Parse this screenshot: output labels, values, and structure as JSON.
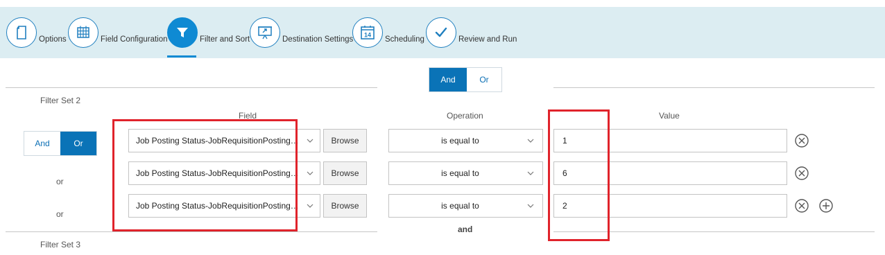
{
  "steps": [
    {
      "label": "Options",
      "icon": "document-icon",
      "active": false
    },
    {
      "label": "Field Configuration",
      "icon": "grid-icon",
      "active": false
    },
    {
      "label": "Filter and Sort",
      "icon": "filter-icon",
      "active": true
    },
    {
      "label": "Destination Settings",
      "icon": "presentation-board-icon",
      "active": false
    },
    {
      "label": "Scheduling",
      "icon": "calendar-icon",
      "active": false,
      "calendar_day": "14"
    },
    {
      "label": "Review and Run",
      "icon": "checkmark-icon",
      "active": false
    }
  ],
  "top_logic": {
    "and_label": "And",
    "or_label": "Or",
    "selected": "And"
  },
  "filter_set_2": {
    "title": "Filter Set 2",
    "logic": {
      "and_label": "And",
      "or_label": "Or",
      "selected": "Or"
    },
    "headers": {
      "field": "Field",
      "operation": "Operation",
      "value": "Value"
    },
    "rows": [
      {
        "connector": "",
        "field": "Job Posting Status-JobRequisitionPosting…",
        "browse": "Browse",
        "operation": "is equal to",
        "value": "1"
      },
      {
        "connector": "or",
        "field": "Job Posting Status-JobRequisitionPosting…",
        "browse": "Browse",
        "operation": "is equal to",
        "value": "6"
      },
      {
        "connector": "or",
        "field": "Job Posting Status-JobRequisitionPosting…",
        "browse": "Browse",
        "operation": "is equal to",
        "value": "2"
      }
    ]
  },
  "between_sets_label": "and",
  "filter_set_3": {
    "title": "Filter Set 3"
  },
  "colors": {
    "accent": "#0a73b7",
    "stepbar_bg": "#dcedf2",
    "highlight": "#e0232b"
  }
}
